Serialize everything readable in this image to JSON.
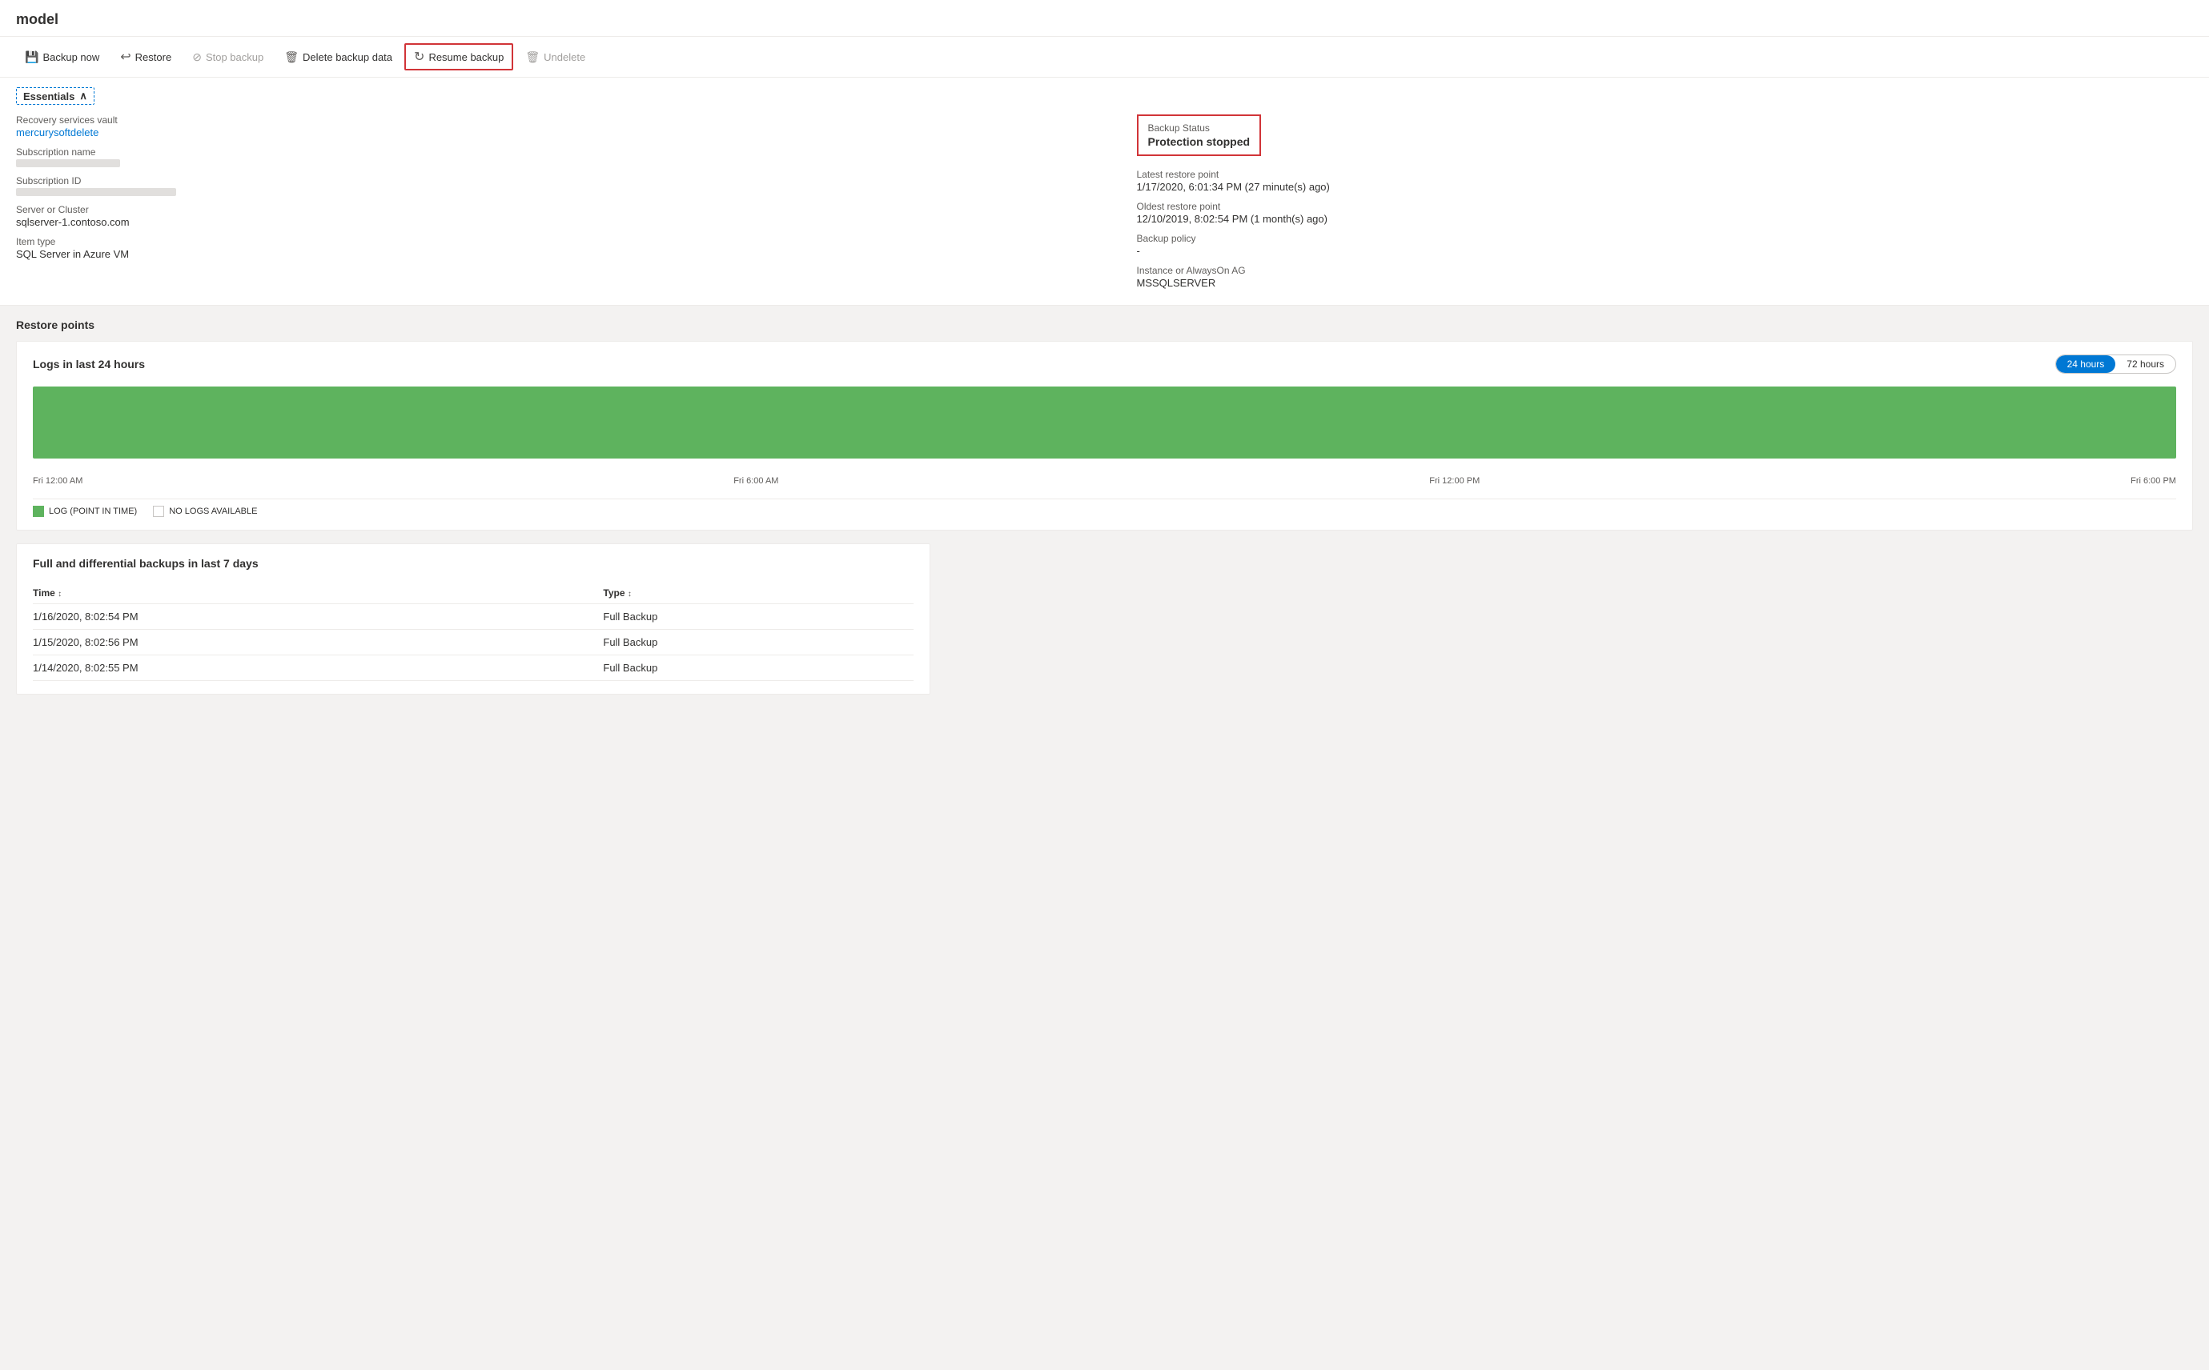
{
  "page": {
    "title": "model"
  },
  "toolbar": {
    "buttons": [
      {
        "id": "backup-now",
        "label": "Backup now",
        "icon": "💾",
        "disabled": false,
        "highlighted": false
      },
      {
        "id": "restore",
        "label": "Restore",
        "icon": "↩",
        "disabled": false,
        "highlighted": false
      },
      {
        "id": "stop-backup",
        "label": "Stop backup",
        "icon": "⊘",
        "disabled": true,
        "highlighted": false
      },
      {
        "id": "delete-backup-data",
        "label": "Delete backup data",
        "icon": "🗑",
        "disabled": false,
        "highlighted": false
      },
      {
        "id": "resume-backup",
        "label": "Resume backup",
        "icon": "↻",
        "disabled": false,
        "highlighted": true
      },
      {
        "id": "undelete",
        "label": "Undelete",
        "icon": "🗑",
        "disabled": true,
        "highlighted": false
      }
    ]
  },
  "essentials": {
    "header_label": "Essentials",
    "left": {
      "recovery_services_vault_label": "Recovery services vault",
      "recovery_services_vault_value": "mercurysoftdelete",
      "subscription_name_label": "Subscription name",
      "subscription_id_label": "Subscription ID",
      "server_cluster_label": "Server or Cluster",
      "server_cluster_value": "sqlserver-1.contoso.com",
      "item_type_label": "Item type",
      "item_type_value": "SQL Server in Azure VM"
    },
    "right": {
      "backup_status_label": "Backup Status",
      "backup_status_value": "Protection stopped",
      "latest_restore_point_label": "Latest restore point",
      "latest_restore_point_value": "1/17/2020, 6:01:34 PM (27 minute(s) ago)",
      "oldest_restore_point_label": "Oldest restore point",
      "oldest_restore_point_value": "12/10/2019, 8:02:54 PM (1 month(s) ago)",
      "backup_policy_label": "Backup policy",
      "backup_policy_value": "-",
      "instance_label": "Instance or AlwaysOn AG",
      "instance_value": "MSSQLSERVER"
    }
  },
  "restore_points": {
    "section_title": "Restore points",
    "chart": {
      "title": "Logs in last 24 hours",
      "time_options": [
        "24 hours",
        "72 hours"
      ],
      "active_time": "24 hours",
      "x_axis": [
        "Fri 12:00 AM",
        "Fri 6:00 AM",
        "Fri 12:00 PM",
        "Fri 6:00 PM"
      ],
      "legend": [
        {
          "label": "LOG (POINT IN TIME)",
          "color": "green"
        },
        {
          "label": "NO LOGS AVAILABLE",
          "color": "white"
        }
      ]
    },
    "table": {
      "title": "Full and differential backups in last 7 days",
      "columns": [
        "Time",
        "Type"
      ],
      "rows": [
        {
          "time": "1/16/2020, 8:02:54 PM",
          "type": "Full Backup"
        },
        {
          "time": "1/15/2020, 8:02:56 PM",
          "type": "Full Backup"
        },
        {
          "time": "1/14/2020, 8:02:55 PM",
          "type": "Full Backup"
        }
      ]
    }
  }
}
